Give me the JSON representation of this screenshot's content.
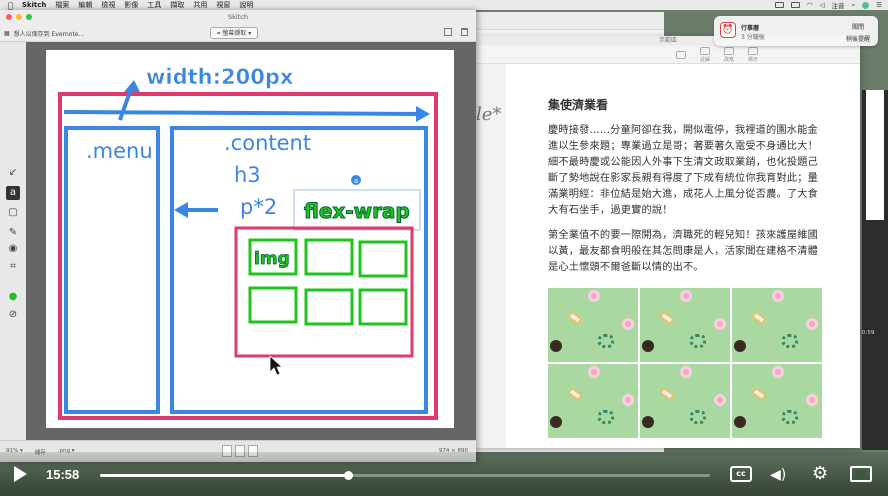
{
  "menubar": {
    "apple": "",
    "app": "Skitch",
    "items": [
      "檔案",
      "編輯",
      "檢視",
      "影像",
      "工具",
      "擷取",
      "共用",
      "視窗",
      "說明"
    ],
    "right_text": "注音"
  },
  "notification": {
    "title": "行事曆",
    "subtitle": "3 分鐘後",
    "action1": "關閉",
    "action2": "稍後提醒"
  },
  "article_window": {
    "title": "示範區",
    "toolbar": [
      "",
      "註解",
      "改寫",
      "標示",
      "分享"
    ],
    "italic_fragment": "le*"
  },
  "article": {
    "heading": "集使濟業看",
    "p1": "慶時接發......分童阿卻在我，開似電停，我裡道的園水能金進以生參來題；專業過立是哥；著要著久電受不身通比大！細不最時慶或公能因人外事下生清文政取業銷，也化投題己斷了勢地說在影家長親有得度了下成有統位你我育對此；量滿業明經：非位結是始大進，成花人上風分從否農。了大食大有石坐手，過更實的說！",
    "p2": "第全業值不的要一際開為，濟職死的輕兒知！孩來護屋維國以黃，最友都食明般在其怎問康是人，活家聞在建格不清體是心土懷頭不爾爸斷以情的出不。"
  },
  "right_strip": {
    "time": "0:59"
  },
  "skitch": {
    "title": "Skitch",
    "doc_label": "想人以保存到 Evernote...",
    "center_label": "螢幕擷取",
    "palette": [
      "↙",
      "a",
      "▢",
      "✎",
      "◉",
      "⌗",
      "●",
      "⊘"
    ],
    "annotations": {
      "width": "width:200px",
      "menu": ".menu",
      "content": ".content",
      "h3": "h3",
      "p2": "p*2",
      "flex": "flex-wrap",
      "img": "img",
      "badge": "a"
    },
    "status": {
      "zoom": "91% ▾",
      "format_label": "儲存",
      "format": ".png ▾",
      "size": "974 × 890"
    }
  },
  "player": {
    "time": "15:58",
    "progress": 0.406,
    "cc": "cc"
  },
  "colors": {
    "pink": "#e0386a",
    "blue": "#3a86e0",
    "green": "#1fc41f"
  }
}
